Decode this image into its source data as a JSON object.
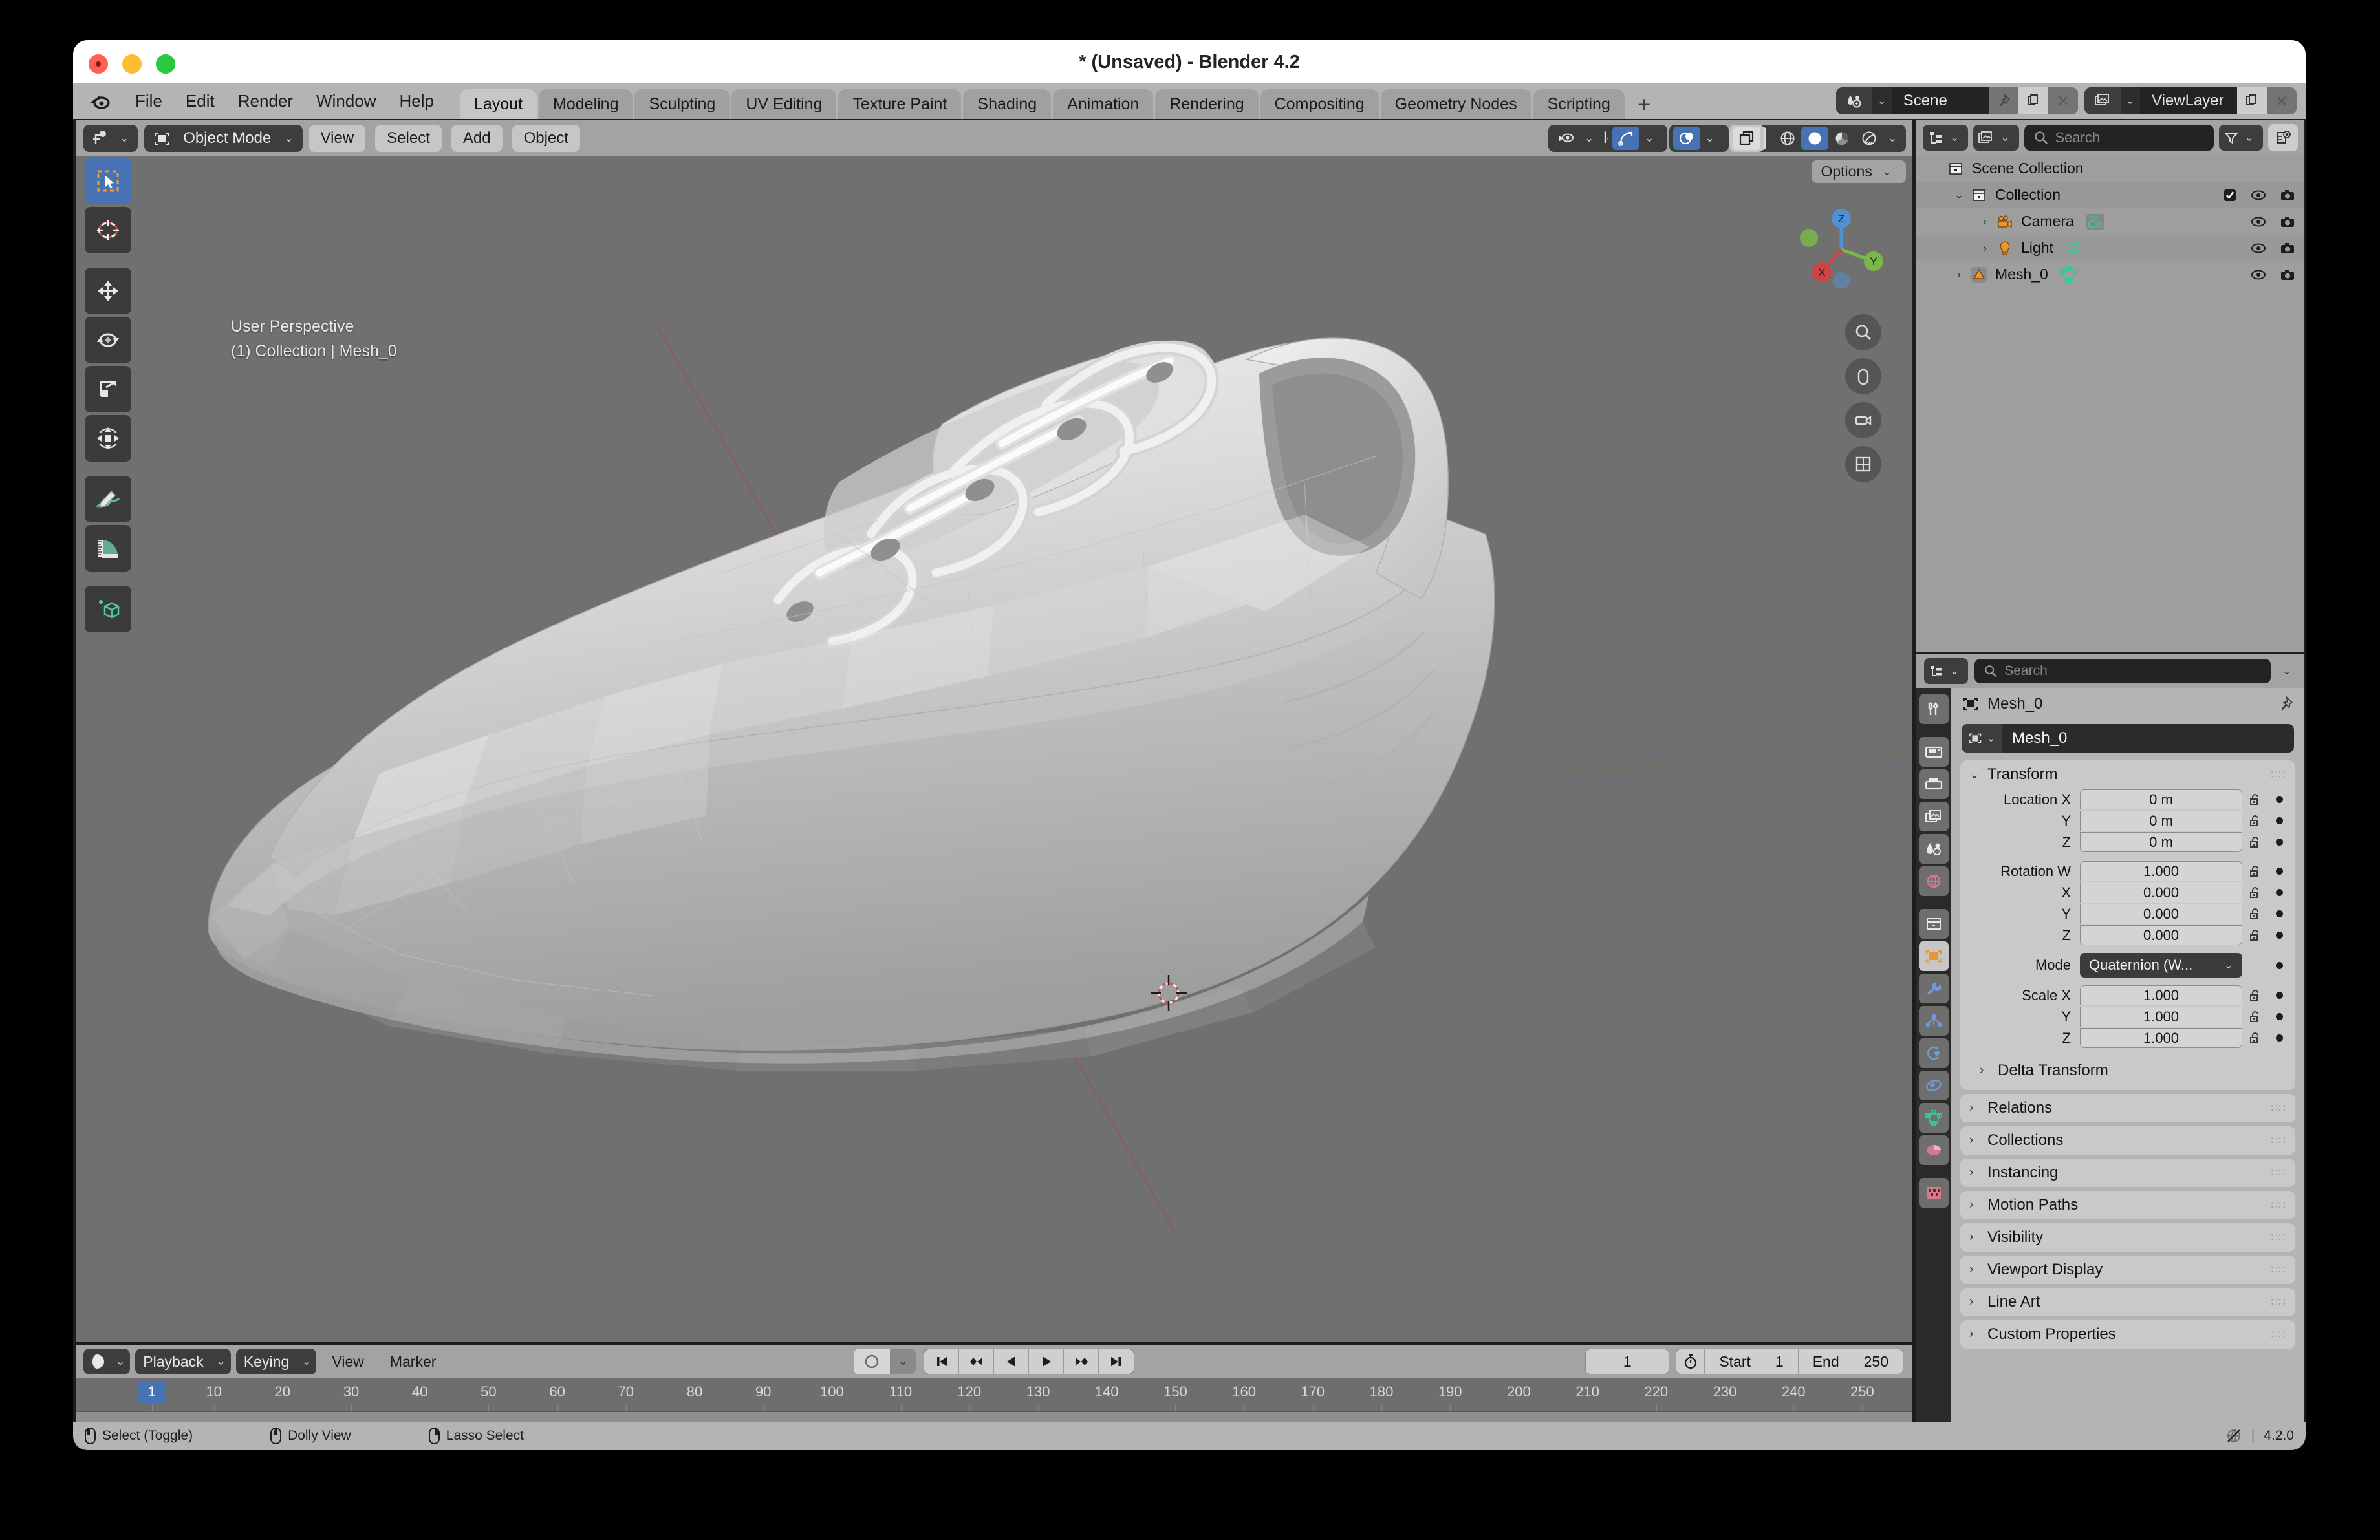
{
  "window": {
    "title": "* (Unsaved) - Blender 4.2"
  },
  "topbar": {
    "menus": [
      "File",
      "Edit",
      "Render",
      "Window",
      "Help"
    ],
    "workspace_tabs": [
      {
        "label": "Layout",
        "active": true
      },
      {
        "label": "Modeling",
        "active": false
      },
      {
        "label": "Sculpting",
        "active": false
      },
      {
        "label": "UV Editing",
        "active": false
      },
      {
        "label": "Texture Paint",
        "active": false
      },
      {
        "label": "Shading",
        "active": false
      },
      {
        "label": "Animation",
        "active": false
      },
      {
        "label": "Rendering",
        "active": false
      },
      {
        "label": "Compositing",
        "active": false
      },
      {
        "label": "Geometry Nodes",
        "active": false
      },
      {
        "label": "Scripting",
        "active": false
      }
    ],
    "add_workspace_label": "+",
    "scene_name": "Scene",
    "viewlayer_name": "ViewLayer"
  },
  "viewport": {
    "mode": "Object Mode",
    "menus": [
      "View",
      "Select",
      "Add",
      "Object"
    ],
    "transform_orientation": "Global",
    "options_label": "Options",
    "overlay_line1": "User Perspective",
    "overlay_line2": "(1) Collection | Mesh_0",
    "tools": [
      {
        "name": "tweak-tool",
        "active": true
      },
      {
        "name": "cursor-tool",
        "active": false
      },
      {
        "name": "move-tool",
        "active": false
      },
      {
        "name": "rotate-tool",
        "active": false
      },
      {
        "name": "scale-tool",
        "active": false
      },
      {
        "name": "transform-tool",
        "active": false
      },
      {
        "name": "annotate-tool",
        "active": false
      },
      {
        "name": "measure-tool",
        "active": false
      },
      {
        "name": "add-cube-tool",
        "active": false
      }
    ],
    "gizmo_axes": [
      "X",
      "Y",
      "Z"
    ]
  },
  "outliner": {
    "search_placeholder": "Search",
    "rows": [
      {
        "label": "Scene Collection",
        "indent": 0,
        "icon": "collection-icon",
        "disclosure": "",
        "checkbox": false,
        "eye": false,
        "camera": false
      },
      {
        "label": "Collection",
        "indent": 1,
        "icon": "collection-icon",
        "disclosure": "v",
        "checkbox": true,
        "eye": true,
        "camera": true
      },
      {
        "label": "Camera",
        "indent": 2,
        "icon": "camera-icon",
        "data_icon": "camera-data-icon",
        "disclosure": ">",
        "checkbox": false,
        "eye": true,
        "camera": true
      },
      {
        "label": "Light",
        "indent": 2,
        "icon": "light-icon",
        "data_icon": "light-data-icon",
        "disclosure": ">",
        "checkbox": false,
        "eye": true,
        "camera": true
      },
      {
        "label": "Mesh_0",
        "indent": 1,
        "icon": "mesh-object-icon",
        "data_icon": "mesh-data-icon",
        "disclosure": ">",
        "checkbox": false,
        "eye": true,
        "camera": true
      }
    ]
  },
  "properties": {
    "search_placeholder": "Search",
    "breadcrumb": "Mesh_0",
    "id_name": "Mesh_0",
    "transform_panel": {
      "title": "Transform",
      "rows": [
        {
          "label": "Location X",
          "value": "0 m"
        },
        {
          "label": "Y",
          "value": "0 m"
        },
        {
          "label": "Z",
          "value": "0 m"
        },
        {
          "label": "Rotation W",
          "value": "1.000"
        },
        {
          "label": "X",
          "value": "0.000"
        },
        {
          "label": "Y",
          "value": "0.000"
        },
        {
          "label": "Z",
          "value": "0.000"
        }
      ],
      "mode_label": "Mode",
      "mode_value": "Quaternion (W...",
      "scale_rows": [
        {
          "label": "Scale X",
          "value": "1.000"
        },
        {
          "label": "Y",
          "value": "1.000"
        },
        {
          "label": "Z",
          "value": "1.000"
        }
      ]
    },
    "collapsed_panels": [
      "Delta Transform",
      "Relations",
      "Collections",
      "Instancing",
      "Motion Paths",
      "Visibility",
      "Viewport Display",
      "Line Art",
      "Custom Properties"
    ],
    "tabs": [
      {
        "name": "tool-tab",
        "selected": false
      },
      {
        "name": "render-tab",
        "selected": false
      },
      {
        "name": "output-tab",
        "selected": false
      },
      {
        "name": "view-layer-tab",
        "selected": false
      },
      {
        "name": "scene-tab",
        "selected": false
      },
      {
        "name": "world-tab",
        "selected": false
      },
      {
        "name": "collection-tab",
        "selected": false
      },
      {
        "name": "object-tab",
        "selected": true
      },
      {
        "name": "modifiers-tab",
        "selected": false
      },
      {
        "name": "particles-tab",
        "selected": false
      },
      {
        "name": "physics-tab",
        "selected": false
      },
      {
        "name": "constraints-tab",
        "selected": false
      },
      {
        "name": "object-data-tab",
        "selected": false
      },
      {
        "name": "material-tab",
        "selected": false
      },
      {
        "name": "texture-tab",
        "selected": false
      }
    ]
  },
  "timeline": {
    "menus_dropdowns": [
      "Playback",
      "Keying"
    ],
    "menus": [
      "View",
      "Marker"
    ],
    "current_frame": "1",
    "start_label": "Start",
    "start_value": "1",
    "end_label": "End",
    "end_value": "250",
    "tick_labels": [
      "1",
      "10",
      "20",
      "30",
      "40",
      "50",
      "60",
      "70",
      "80",
      "90",
      "100",
      "110",
      "120",
      "130",
      "140",
      "150",
      "160",
      "170",
      "180",
      "190",
      "200",
      "210",
      "220",
      "230",
      "240",
      "250"
    ],
    "playhead_frame": "1"
  },
  "statusbar": {
    "items": [
      {
        "label": "Select (Toggle)",
        "button": "left"
      },
      {
        "label": "Dolly View",
        "button": "mid"
      },
      {
        "label": "Lasso Select",
        "button": "right"
      }
    ],
    "version": "4.2.0"
  },
  "colors": {
    "accent_blue": "#4772b3",
    "viewport_bg": "#707070",
    "panel_bg": "#b4b4b4",
    "header_bg": "#a3a3a3",
    "field_dark": "#232323",
    "mesh_green": "#31c99a",
    "object_orange": "#e8962f"
  }
}
